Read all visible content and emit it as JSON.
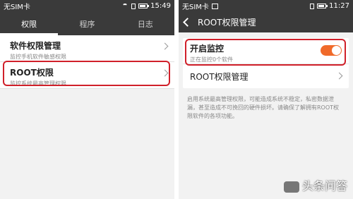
{
  "left": {
    "status": {
      "carrier": "无SIM卡",
      "time": "15:49"
    },
    "tabs": [
      {
        "label": "权限"
      },
      {
        "label": "程序"
      },
      {
        "label": "日志"
      }
    ],
    "items": [
      {
        "title": "软件权限管理",
        "subtitle": "监控手机软件敏感权限"
      },
      {
        "title": "ROOT权限",
        "subtitle": "监控系统最高管理权限"
      }
    ]
  },
  "right": {
    "status": {
      "carrier": "无SIM卡",
      "time": "11:27"
    },
    "header": {
      "title": "ROOT权限管理"
    },
    "toggle_row": {
      "title": "开启监控",
      "subtitle": "正在监控0个软件",
      "state": "on"
    },
    "root_row": {
      "title": "ROOT权限管理"
    },
    "description": "启用系统最高管理权限，可能造成系统不稳定，私密数据泄漏，甚至造成不可挽回的硬件损坏。请确保了解拥有ROOT权限软件的各项功能。"
  },
  "watermark": "头条问答",
  "colors": {
    "toggle_on": "#f06a2a",
    "highlight": "#d0202a",
    "bar": "#3a3a3a"
  }
}
